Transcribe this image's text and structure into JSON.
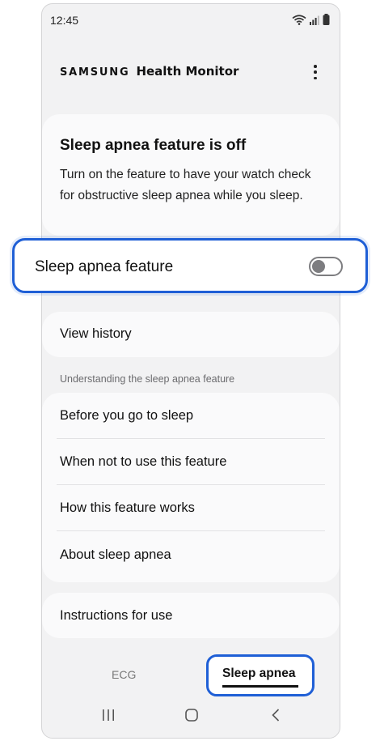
{
  "status": {
    "time": "12:45"
  },
  "header": {
    "brand": "SAMSUNG",
    "product": "Health Monitor"
  },
  "info": {
    "title": "Sleep apnea feature is off",
    "description": "Turn on the feature to have your watch check for obstructive sleep apnea while you sleep."
  },
  "feature_toggle": {
    "label": "Sleep apnea feature",
    "state": "off"
  },
  "history": {
    "label": "View history"
  },
  "understanding": {
    "section_label": "Understanding the sleep apnea feature",
    "items": [
      {
        "label": "Before you go to sleep"
      },
      {
        "label": "When not to use this feature"
      },
      {
        "label": "How this feature works"
      },
      {
        "label": "About sleep apnea"
      }
    ]
  },
  "instructions": {
    "label": "Instructions for use"
  },
  "tabs": [
    {
      "label": "ECG",
      "active": false
    },
    {
      "label": "Sleep apnea",
      "active": true
    }
  ],
  "icons": {
    "wifi": "wifi-icon",
    "signal": "signal-icon",
    "battery": "battery-icon",
    "more": "more-options-icon",
    "recents": "recents-icon",
    "home": "home-icon",
    "back": "back-icon"
  },
  "colors": {
    "highlight": "#1f5fd6",
    "background": "#f2f2f3",
    "card": "#fafafb"
  }
}
